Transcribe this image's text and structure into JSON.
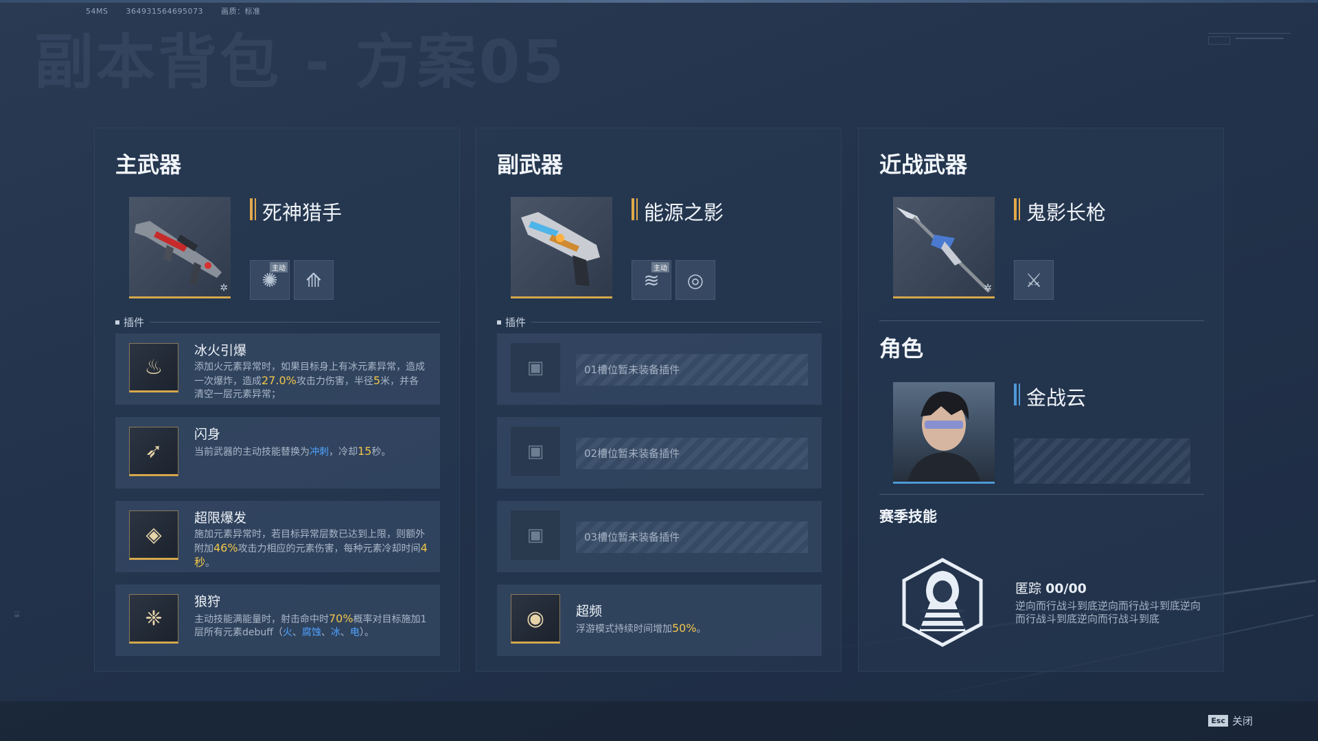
{
  "sysinfo": {
    "ms": "54MS",
    "id": "364931564695073",
    "quality": "画质：标准"
  },
  "page_title": "副本背包 - 方案05",
  "primary": {
    "title": "主武器",
    "weapon_name": "死神猎手",
    "active_tag": "主动",
    "plugins_label": "插件",
    "plugins": [
      {
        "name": "冰火引爆",
        "icon": "fire-ice-icon",
        "d1": "添加火元素异常时，如果目标身上有冰元素异常，造成一次爆炸，造成",
        "v1": "27.0%",
        "d2": "攻击力伤害，半径",
        "v2": "5",
        "d3": "米，并各清空一层元素异常；"
      },
      {
        "name": "闪身",
        "icon": "dash-icon",
        "d1": "当前武器的主动技能替换为",
        "b1": "冲刺",
        "d2": "，冷却",
        "v1": "15",
        "d3": "秒。"
      },
      {
        "name": "超限爆发",
        "icon": "diamond-icon",
        "d1": "施加元素异常时，若目标异常层数已达到上限，则额外附加",
        "v1": "46%",
        "d2": "攻击力相应的元素伤害，每种元素冷却时间",
        "v2": "4秒",
        "d3": "。"
      },
      {
        "name": "狼狩",
        "icon": "wolf-icon",
        "d1": "主动技能满能量时，射击命中时",
        "v1": "70%",
        "d2": "概率对目标施加1层所有元素debuff（",
        "b1": "火",
        "s1": "、",
        "b2": "腐蚀",
        "s2": "、",
        "b3": "冰",
        "s3": "、",
        "b4": "电",
        "d3": "）。"
      }
    ]
  },
  "secondary": {
    "title": "副武器",
    "weapon_name": "能源之影",
    "active_tag": "主动",
    "plugins_label": "插件",
    "empty_slots": [
      "01槽位暂未装备插件",
      "02槽位暂未装备插件",
      "03槽位暂未装备插件"
    ],
    "plugin": {
      "name": "超频",
      "d1": "浮游模式持续时间增加",
      "v1": "50%",
      "d2": "。"
    }
  },
  "melee": {
    "title": "近战武器",
    "weapon_name": "鬼影长枪"
  },
  "role": {
    "title": "角色",
    "name": "金战云",
    "season_title": "赛季技能",
    "season_skill_name": "匿踪",
    "season_skill_count": "00/00",
    "season_skill_desc": "逆向而行战斗到底逆向而行战斗到底逆向而行战斗到底逆向而行战斗到底"
  },
  "footer": {
    "esc_key": "Esc",
    "close_label": "关闭"
  },
  "colors": {
    "gold": "#e0a94a",
    "highlight_yellow": "#f1c64a",
    "highlight_blue": "#4ea3ff",
    "role_blue": "#4e9ad6"
  }
}
